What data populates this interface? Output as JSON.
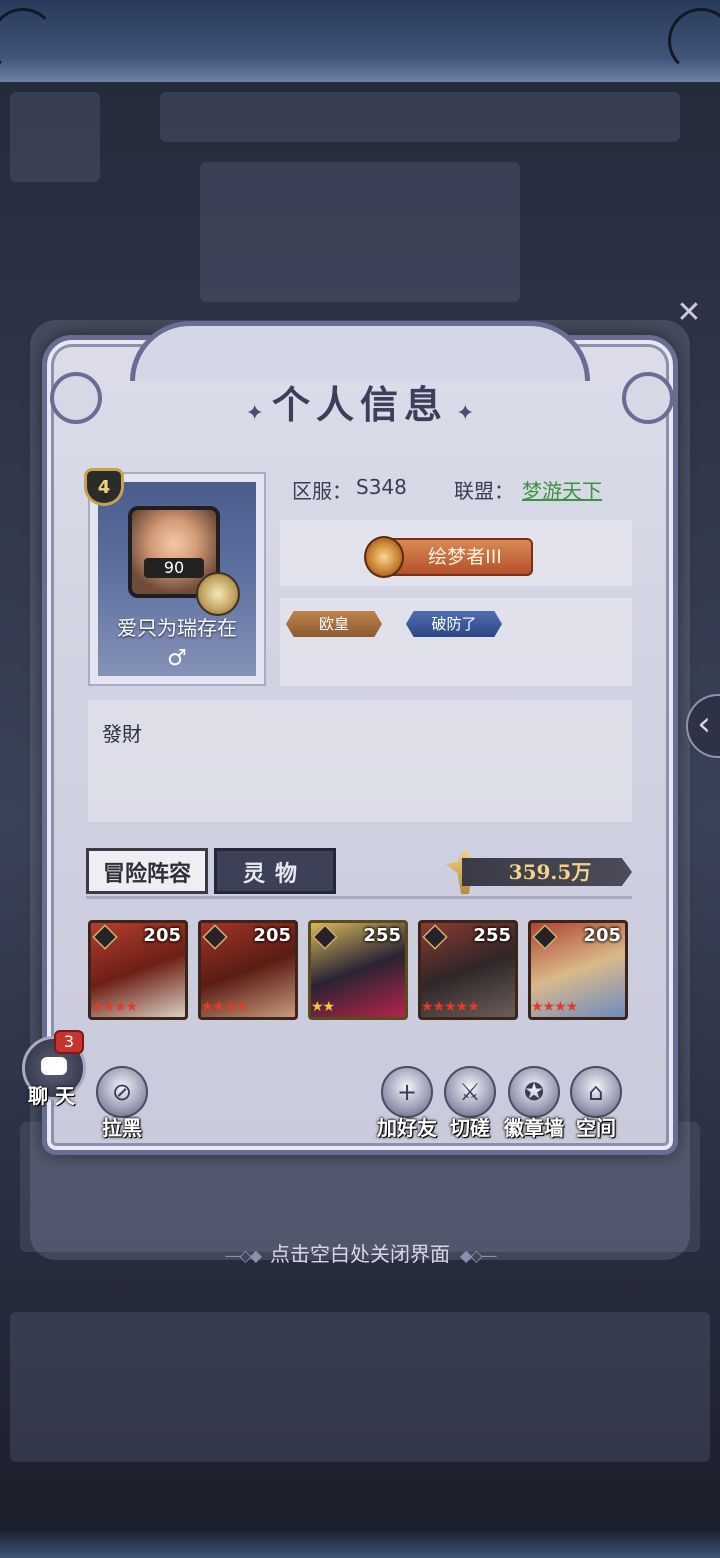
{
  "dialog": {
    "title": "个人信息",
    "close_glyph": "✕"
  },
  "profile": {
    "level": "4",
    "portrait_level": "90",
    "name": "爱只为瑞存在",
    "gender": "♂",
    "server_label": "区服：",
    "server_value": "S348",
    "alliance_label": "联盟：",
    "alliance_value": "梦游天下",
    "rank": "绘梦者III",
    "tags": [
      "欧皇",
      "破防了"
    ],
    "signature": "發財"
  },
  "tabs": {
    "adventure_lineup": "冒险阵容",
    "spirit": "灵物"
  },
  "power": {
    "value": "359.5万"
  },
  "heroes": [
    {
      "level": "205",
      "stars": "★★★★",
      "star_color": "red"
    },
    {
      "level": "205",
      "stars": "★★★★",
      "star_color": "red"
    },
    {
      "level": "255",
      "stars": "★★",
      "star_color": "gold"
    },
    {
      "level": "255",
      "stars": "★★★★★",
      "star_color": "red"
    },
    {
      "level": "205",
      "stars": "★★★★",
      "star_color": "red"
    }
  ],
  "actions": {
    "block": "拉黑",
    "add_friend": "加好友",
    "spar": "切磋",
    "badge_wall": "徽章墙",
    "space": "空间"
  },
  "chat": {
    "label": "聊 天",
    "unread": "3"
  },
  "hint": "点击空白处关闭界面",
  "colors": {
    "alliance": "#3c9441",
    "power_text": "#f4d487",
    "panel_border": "#6a6d93"
  }
}
